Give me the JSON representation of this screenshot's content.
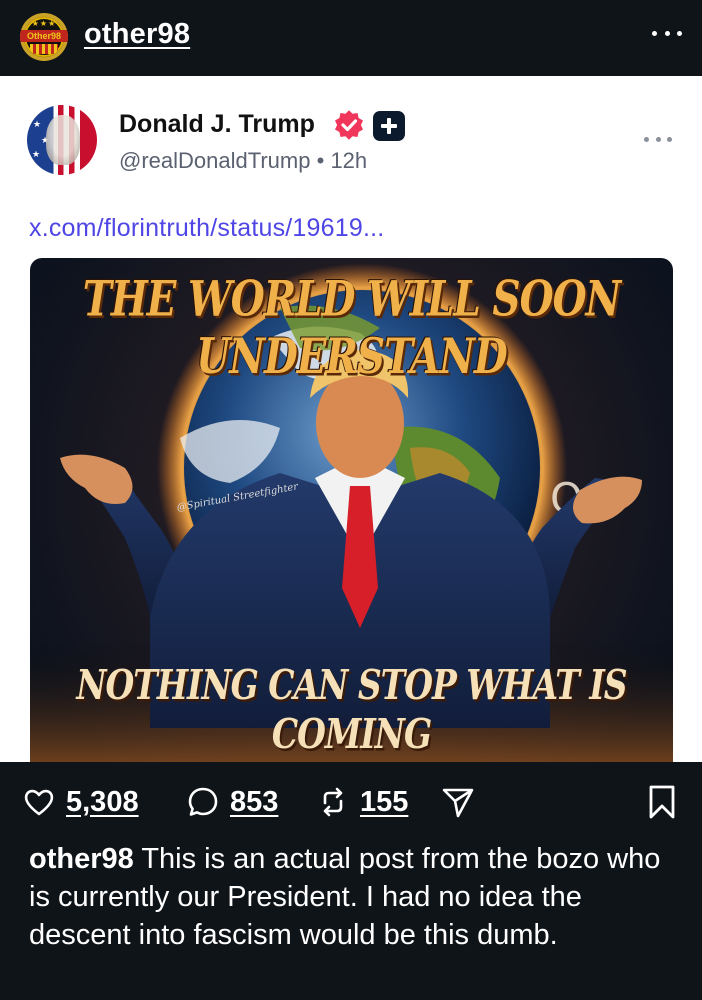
{
  "header": {
    "username": "other98",
    "avatar_text": "Other98",
    "more_icon": "more-horizontal-icon"
  },
  "post": {
    "author_name": "Donald J. Trump",
    "handle": "@realDonaldTrump",
    "separator": "•",
    "time": "12h",
    "link": "x.com/florintruth/status/19619...",
    "image": {
      "headline_top": "THE WORLD WILL SOON UNDERSTAND",
      "headline_bottom": "NOTHING CAN STOP WHAT IS COMING",
      "watermark": "@Spiritual Streetfighter"
    },
    "colors": {
      "verified": "#f0365a",
      "link": "#4f46e5"
    }
  },
  "actions": {
    "likes": "5,308",
    "comments": "853",
    "reposts": "155"
  },
  "caption": {
    "username": "other98",
    "text": "This is an actual post from the bozo who is currently our President. I had no idea the descent into fascism would be this dumb."
  }
}
